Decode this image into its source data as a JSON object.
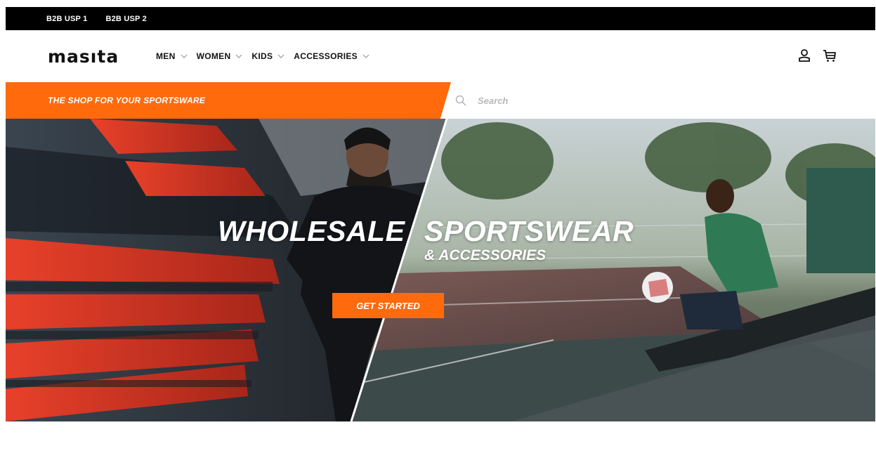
{
  "usp_bar": {
    "items": [
      "B2B USP 1",
      "B2B USP 2"
    ]
  },
  "header": {
    "logo_text": "masıta",
    "nav": [
      {
        "label": "MEN"
      },
      {
        "label": "WOMEN"
      },
      {
        "label": "KIDS"
      },
      {
        "label": "ACCESSORIES"
      }
    ],
    "icons": [
      "account-icon",
      "cart-icon"
    ]
  },
  "promo": {
    "tagline": "THE SHOP FOR YOUR SPORTSWARE"
  },
  "search": {
    "placeholder": "Search",
    "icon": "search-icon"
  },
  "hero": {
    "title_left": "WHOLESALE",
    "title_right": "SPORTSWEAR",
    "subtitle": "& ACCESSORIES",
    "cta_label": "GET STARTED"
  },
  "colors": {
    "accent": "#ff6a0d",
    "topbar": "#000000",
    "text": "#111111"
  }
}
